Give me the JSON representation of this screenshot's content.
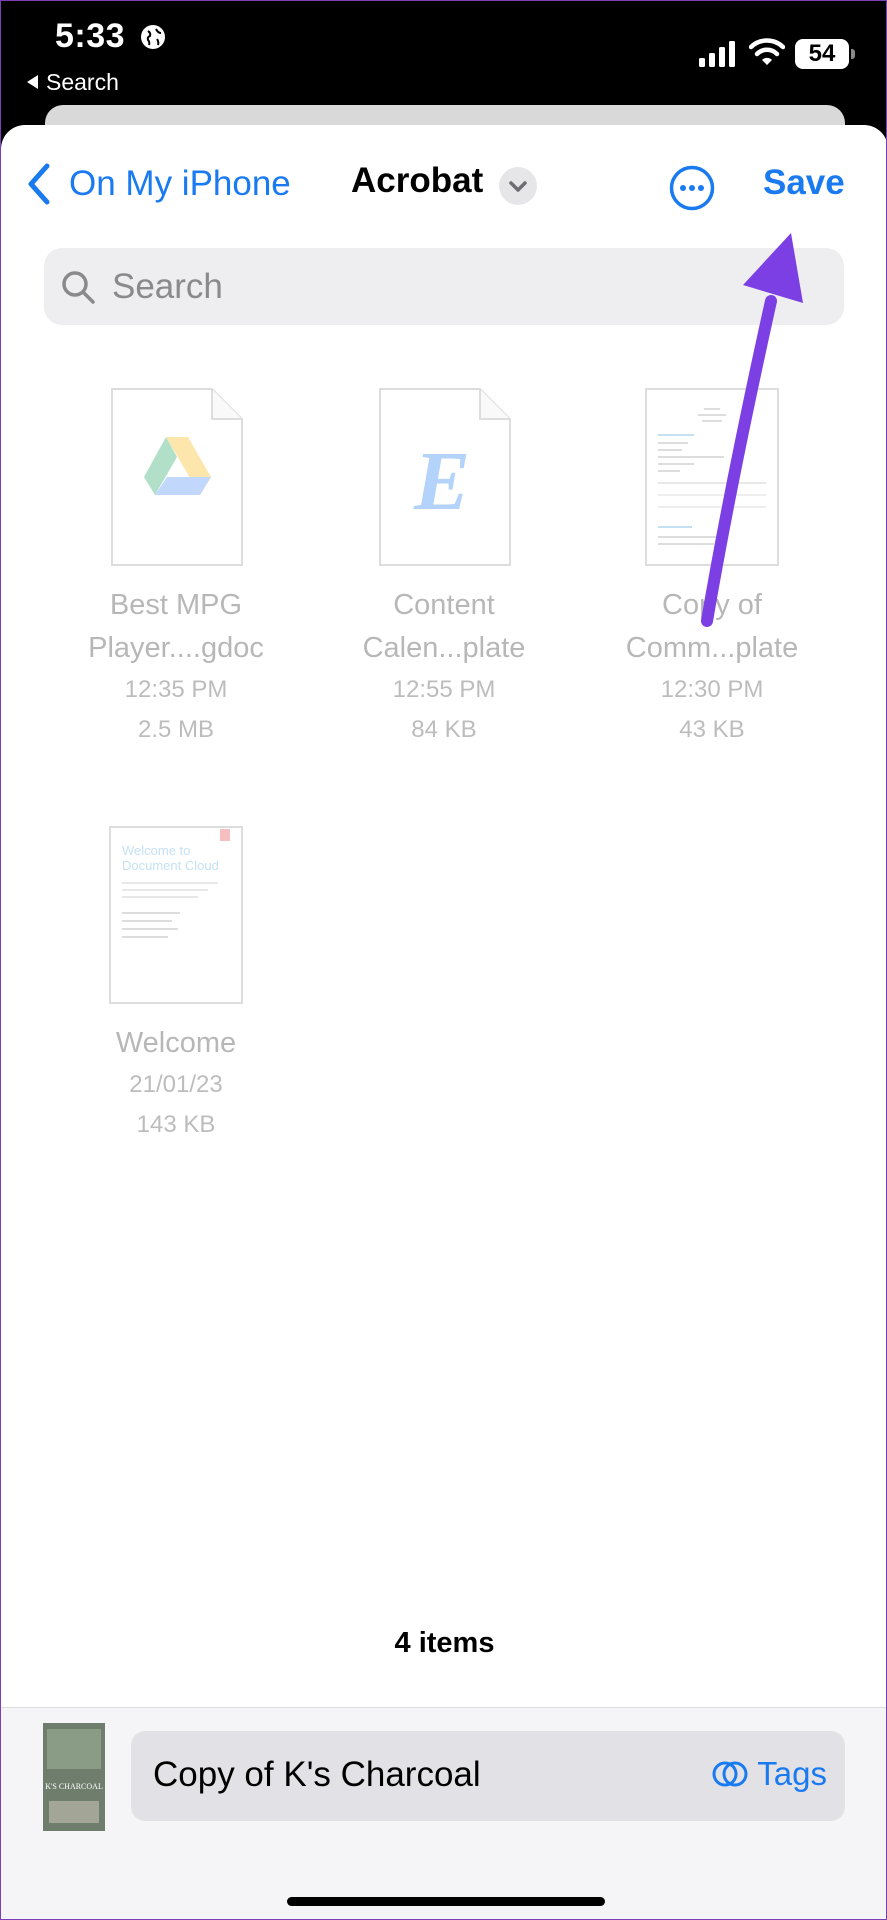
{
  "status_bar": {
    "time": "5:33",
    "back_app": "Search",
    "battery": "54"
  },
  "nav": {
    "back_label": "On My iPhone",
    "title": "Acrobat",
    "save_label": "Save"
  },
  "search": {
    "placeholder": "Search"
  },
  "files": [
    {
      "name_line1": "Best MPG",
      "name_line2": "Player....gdoc",
      "time": "12:35 PM",
      "size": "2.5 MB",
      "icon": "google-drive-icon"
    },
    {
      "name_line1": "Content",
      "name_line2": "Calen...plate",
      "time": "12:55 PM",
      "size": "84 KB",
      "icon": "letter-e-icon"
    },
    {
      "name_line1": "Copy of",
      "name_line2": "Comm...plate",
      "time": "12:30 PM",
      "size": "43 KB",
      "icon": "document-preview-icon"
    },
    {
      "name_line1": "Welcome",
      "name_line2": "",
      "time": "21/01/23",
      "size": "143 KB",
      "icon": "document-preview-icon",
      "preview_title": "Welcome to Document Cloud"
    }
  ],
  "items_count": "4 items",
  "bottom": {
    "filename": "Copy of K's Charcoal",
    "tags_label": "Tags",
    "thumb_title": "K'S CHARCOAL"
  },
  "colors": {
    "accent": "#1a7af0",
    "arrow": "#7b3fe4"
  }
}
